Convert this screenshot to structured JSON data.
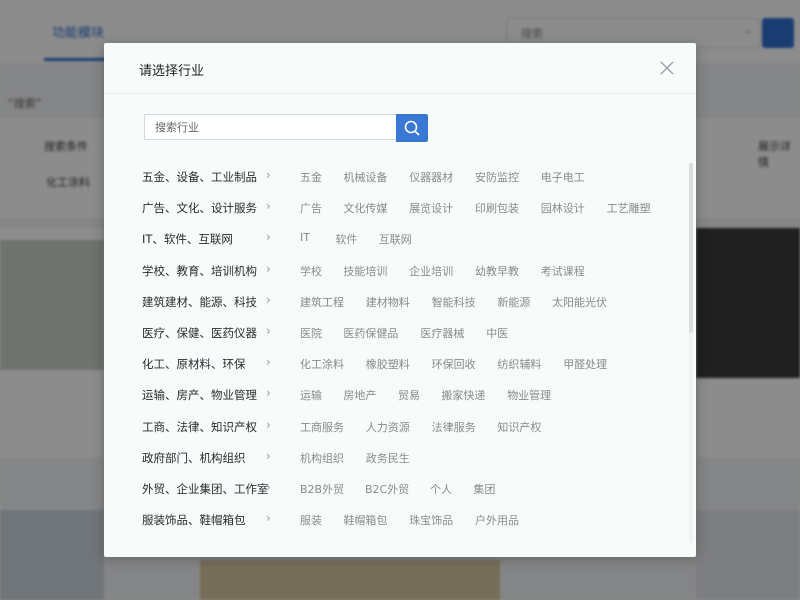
{
  "background": {
    "tab_label": "功能模块",
    "search_value": "搜索",
    "breadcrumb": "“搜索”",
    "row_a": "搜索条件",
    "row_b": "化工涂料",
    "right_a": "展示详情"
  },
  "modal": {
    "title": "请选择行业",
    "search": {
      "placeholder": "搜索行业",
      "value": ""
    },
    "categories": [
      {
        "label": "五金、设备、工业制品",
        "items": [
          "五金",
          "机械设备",
          "仪器器材",
          "安防监控",
          "电子电工"
        ]
      },
      {
        "label": "广告、文化、设计服务",
        "items": [
          "广告",
          "文化传媒",
          "展览设计",
          "印刷包装",
          "园林设计",
          "工艺雕塑"
        ]
      },
      {
        "label": "IT、软件、互联网",
        "items": [
          "IT",
          "软件",
          "互联网"
        ]
      },
      {
        "label": "学校、教育、培训机构",
        "items": [
          "学校",
          "技能培训",
          "企业培训",
          "幼教早教",
          "考试课程"
        ]
      },
      {
        "label": "建筑建材、能源、科技",
        "items": [
          "建筑工程",
          "建材物料",
          "智能科技",
          "新能源",
          "太阳能光伏"
        ]
      },
      {
        "label": "医疗、保健、医药仪器",
        "items": [
          "医院",
          "医药保健品",
          "医疗器械",
          "中医"
        ]
      },
      {
        "label": "化工、原材料、环保",
        "items": [
          "化工涂料",
          "橡胶塑料",
          "环保回收",
          "纺织辅料",
          "甲醛处理"
        ]
      },
      {
        "label": "运输、房产、物业管理",
        "items": [
          "运输",
          "房地产",
          "贸易",
          "搬家快递",
          "物业管理"
        ]
      },
      {
        "label": "工商、法律、知识产权",
        "items": [
          "工商服务",
          "人力资源",
          "法律服务",
          "知识产权"
        ]
      },
      {
        "label": "政府部门、机构组织",
        "items": [
          "机构组织",
          "政务民生"
        ]
      },
      {
        "label": "外贸、企业集团、工作室",
        "items": [
          "B2B外贸",
          "B2C外贸",
          "个人",
          "集团"
        ]
      },
      {
        "label": "服装饰品、鞋帽箱包",
        "items": [
          "服装",
          "鞋帽箱包",
          "珠宝饰品",
          "户外用品"
        ]
      }
    ]
  },
  "icons": {
    "close": "close-icon",
    "search": "search-icon",
    "chevron": "chevron-right-icon"
  },
  "colors": {
    "accent": "#3a78d6",
    "modal_bg": "#f7fcfb",
    "sub_text": "#8a8a8a",
    "cat_text": "#2b2b2b"
  }
}
